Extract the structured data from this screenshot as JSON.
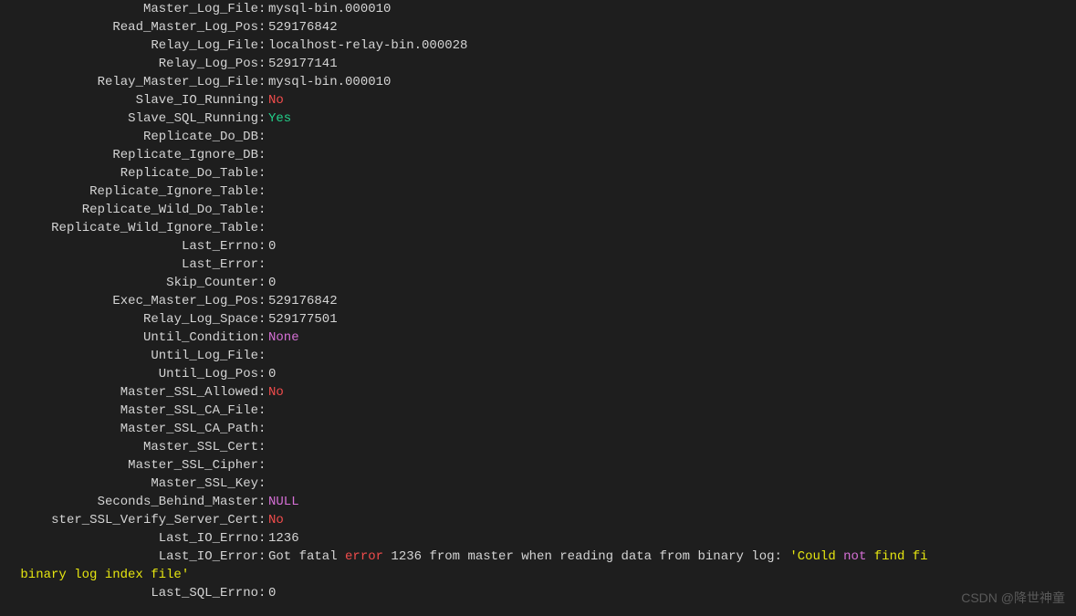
{
  "rows": [
    {
      "label": "Master_Log_File",
      "value": "mysql-bin.000010"
    },
    {
      "label": "Read_Master_Log_Pos",
      "value": "529176842"
    },
    {
      "label": "Relay_Log_File",
      "value": "localhost-relay-bin.000028"
    },
    {
      "label": "Relay_Log_Pos",
      "value": "529177141"
    },
    {
      "label": "Relay_Master_Log_File",
      "value": "mysql-bin.000010"
    },
    {
      "label": "Slave_IO_Running",
      "value": "No",
      "cls": "red"
    },
    {
      "label": "Slave_SQL_Running",
      "value": "Yes",
      "cls": "green"
    },
    {
      "label": "Replicate_Do_DB",
      "value": ""
    },
    {
      "label": "Replicate_Ignore_DB",
      "value": ""
    },
    {
      "label": "Replicate_Do_Table",
      "value": ""
    },
    {
      "label": "Replicate_Ignore_Table",
      "value": ""
    },
    {
      "label": "Replicate_Wild_Do_Table",
      "value": ""
    },
    {
      "label": "Replicate_Wild_Ignore_Table",
      "value": ""
    },
    {
      "label": "Last_Errno",
      "value": "0"
    },
    {
      "label": "Last_Error",
      "value": ""
    },
    {
      "label": "Skip_Counter",
      "value": "0"
    },
    {
      "label": "Exec_Master_Log_Pos",
      "value": "529176842"
    },
    {
      "label": "Relay_Log_Space",
      "value": "529177501"
    },
    {
      "label": "Until_Condition",
      "value": "None",
      "cls": "magenta"
    },
    {
      "label": "Until_Log_File",
      "value": ""
    },
    {
      "label": "Until_Log_Pos",
      "value": "0"
    },
    {
      "label": "Master_SSL_Allowed",
      "value": "No",
      "cls": "red"
    },
    {
      "label": "Master_SSL_CA_File",
      "value": ""
    },
    {
      "label": "Master_SSL_CA_Path",
      "value": ""
    },
    {
      "label": "Master_SSL_Cert",
      "value": ""
    },
    {
      "label": "Master_SSL_Cipher",
      "value": ""
    },
    {
      "label": "Master_SSL_Key",
      "value": ""
    },
    {
      "label": "Seconds_Behind_Master",
      "value": "NULL",
      "cls": "magenta"
    },
    {
      "label": "ster_SSL_Verify_Server_Cert",
      "value": "No",
      "cls": "red"
    },
    {
      "label": "Last_IO_Errno",
      "value": "1236"
    }
  ],
  "last_io_error": {
    "label": "Last_IO_Error",
    "parts": {
      "p1": "Got fatal ",
      "err": "error",
      "p2": " 1236 from master when reading data from binary log: ",
      "q1": "'",
      "p3": "Could ",
      "not": "not",
      "p4": " find fi"
    },
    "continuation": " binary log index file'"
  },
  "last_sql_errno": {
    "label": "Last_SQL_Errno",
    "value": "0"
  },
  "watermark": "CSDN @降世神童",
  "colon": ": "
}
